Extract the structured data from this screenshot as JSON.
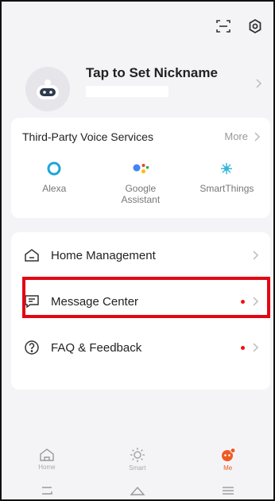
{
  "profile": {
    "nickname": "Tap to Set Nickname"
  },
  "voice_services": {
    "title": "Third-Party Voice Services",
    "more_label": "More",
    "items": [
      {
        "label": "Alexa",
        "icon": "alexa-icon"
      },
      {
        "label": "Google\nAssistant",
        "icon": "google-assistant-icon"
      },
      {
        "label": "SmartThings",
        "icon": "smartthings-icon"
      }
    ]
  },
  "menu": {
    "home_management": "Home Management",
    "message_center": "Message Center",
    "faq_feedback": "FAQ & Feedback"
  },
  "tabs": [
    {
      "label": "Home",
      "icon": "home-icon"
    },
    {
      "label": "Smart",
      "icon": "sun-icon"
    },
    {
      "label": "Me",
      "icon": "me-icon"
    }
  ],
  "colors": {
    "accent": "#ee5a24",
    "badge": "#e11111",
    "highlight": "#e30613"
  }
}
